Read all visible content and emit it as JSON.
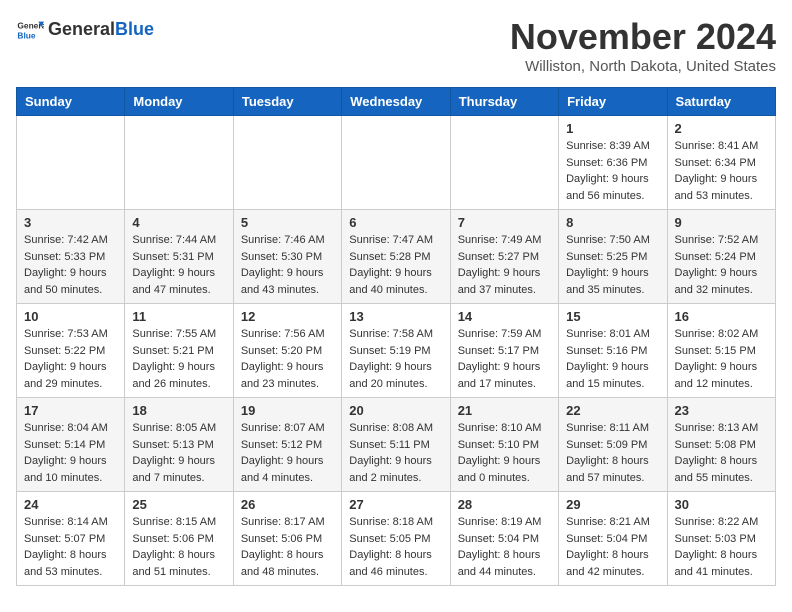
{
  "header": {
    "logo_general": "General",
    "logo_blue": "Blue",
    "month_title": "November 2024",
    "location": "Williston, North Dakota, United States"
  },
  "days_of_week": [
    "Sunday",
    "Monday",
    "Tuesday",
    "Wednesday",
    "Thursday",
    "Friday",
    "Saturday"
  ],
  "weeks": [
    [
      {
        "day": "",
        "info": ""
      },
      {
        "day": "",
        "info": ""
      },
      {
        "day": "",
        "info": ""
      },
      {
        "day": "",
        "info": ""
      },
      {
        "day": "",
        "info": ""
      },
      {
        "day": "1",
        "info": "Sunrise: 8:39 AM\nSunset: 6:36 PM\nDaylight: 9 hours and 56 minutes."
      },
      {
        "day": "2",
        "info": "Sunrise: 8:41 AM\nSunset: 6:34 PM\nDaylight: 9 hours and 53 minutes."
      }
    ],
    [
      {
        "day": "3",
        "info": "Sunrise: 7:42 AM\nSunset: 5:33 PM\nDaylight: 9 hours and 50 minutes."
      },
      {
        "day": "4",
        "info": "Sunrise: 7:44 AM\nSunset: 5:31 PM\nDaylight: 9 hours and 47 minutes."
      },
      {
        "day": "5",
        "info": "Sunrise: 7:46 AM\nSunset: 5:30 PM\nDaylight: 9 hours and 43 minutes."
      },
      {
        "day": "6",
        "info": "Sunrise: 7:47 AM\nSunset: 5:28 PM\nDaylight: 9 hours and 40 minutes."
      },
      {
        "day": "7",
        "info": "Sunrise: 7:49 AM\nSunset: 5:27 PM\nDaylight: 9 hours and 37 minutes."
      },
      {
        "day": "8",
        "info": "Sunrise: 7:50 AM\nSunset: 5:25 PM\nDaylight: 9 hours and 35 minutes."
      },
      {
        "day": "9",
        "info": "Sunrise: 7:52 AM\nSunset: 5:24 PM\nDaylight: 9 hours and 32 minutes."
      }
    ],
    [
      {
        "day": "10",
        "info": "Sunrise: 7:53 AM\nSunset: 5:22 PM\nDaylight: 9 hours and 29 minutes."
      },
      {
        "day": "11",
        "info": "Sunrise: 7:55 AM\nSunset: 5:21 PM\nDaylight: 9 hours and 26 minutes."
      },
      {
        "day": "12",
        "info": "Sunrise: 7:56 AM\nSunset: 5:20 PM\nDaylight: 9 hours and 23 minutes."
      },
      {
        "day": "13",
        "info": "Sunrise: 7:58 AM\nSunset: 5:19 PM\nDaylight: 9 hours and 20 minutes."
      },
      {
        "day": "14",
        "info": "Sunrise: 7:59 AM\nSunset: 5:17 PM\nDaylight: 9 hours and 17 minutes."
      },
      {
        "day": "15",
        "info": "Sunrise: 8:01 AM\nSunset: 5:16 PM\nDaylight: 9 hours and 15 minutes."
      },
      {
        "day": "16",
        "info": "Sunrise: 8:02 AM\nSunset: 5:15 PM\nDaylight: 9 hours and 12 minutes."
      }
    ],
    [
      {
        "day": "17",
        "info": "Sunrise: 8:04 AM\nSunset: 5:14 PM\nDaylight: 9 hours and 10 minutes."
      },
      {
        "day": "18",
        "info": "Sunrise: 8:05 AM\nSunset: 5:13 PM\nDaylight: 9 hours and 7 minutes."
      },
      {
        "day": "19",
        "info": "Sunrise: 8:07 AM\nSunset: 5:12 PM\nDaylight: 9 hours and 4 minutes."
      },
      {
        "day": "20",
        "info": "Sunrise: 8:08 AM\nSunset: 5:11 PM\nDaylight: 9 hours and 2 minutes."
      },
      {
        "day": "21",
        "info": "Sunrise: 8:10 AM\nSunset: 5:10 PM\nDaylight: 9 hours and 0 minutes."
      },
      {
        "day": "22",
        "info": "Sunrise: 8:11 AM\nSunset: 5:09 PM\nDaylight: 8 hours and 57 minutes."
      },
      {
        "day": "23",
        "info": "Sunrise: 8:13 AM\nSunset: 5:08 PM\nDaylight: 8 hours and 55 minutes."
      }
    ],
    [
      {
        "day": "24",
        "info": "Sunrise: 8:14 AM\nSunset: 5:07 PM\nDaylight: 8 hours and 53 minutes."
      },
      {
        "day": "25",
        "info": "Sunrise: 8:15 AM\nSunset: 5:06 PM\nDaylight: 8 hours and 51 minutes."
      },
      {
        "day": "26",
        "info": "Sunrise: 8:17 AM\nSunset: 5:06 PM\nDaylight: 8 hours and 48 minutes."
      },
      {
        "day": "27",
        "info": "Sunrise: 8:18 AM\nSunset: 5:05 PM\nDaylight: 8 hours and 46 minutes."
      },
      {
        "day": "28",
        "info": "Sunrise: 8:19 AM\nSunset: 5:04 PM\nDaylight: 8 hours and 44 minutes."
      },
      {
        "day": "29",
        "info": "Sunrise: 8:21 AM\nSunset: 5:04 PM\nDaylight: 8 hours and 42 minutes."
      },
      {
        "day": "30",
        "info": "Sunrise: 8:22 AM\nSunset: 5:03 PM\nDaylight: 8 hours and 41 minutes."
      }
    ]
  ]
}
